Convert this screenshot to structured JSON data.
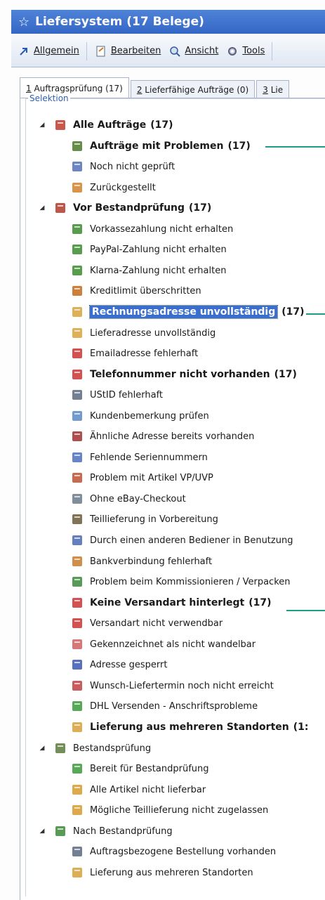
{
  "window": {
    "title": "Liefersystem (17 Belege)"
  },
  "toolbar": [
    {
      "label": "Allgemein",
      "icon": "arrow-icon"
    },
    {
      "label": "Bearbeiten",
      "icon": "edit-icon"
    },
    {
      "label": "Ansicht",
      "icon": "view-icon"
    },
    {
      "label": "Tools",
      "icon": "tools-icon"
    }
  ],
  "tabs": [
    {
      "num": "1",
      "label": "Auftragsprüfung (17)"
    },
    {
      "num": "2",
      "label": "Lieferfähige Aufträge (0)"
    },
    {
      "num": "3",
      "label": "Lie"
    }
  ],
  "group": {
    "label": "Selektion"
  },
  "tree": [
    {
      "label": "Alle Aufträge",
      "count": "(17)",
      "bold": true,
      "level": 0,
      "expander": "open",
      "icon": "door-icon",
      "color": "#c0392b"
    },
    {
      "label": "Aufträge mit Problemen",
      "count": "(17)",
      "bold": true,
      "level": 1,
      "icon": "document-warning-icon",
      "color": "#4a7a2a"
    },
    {
      "label": "Noch nicht geprüft",
      "count": "",
      "bold": false,
      "level": 1,
      "icon": "document-icon",
      "color": "#5470b8"
    },
    {
      "label": "Zurückgestellt",
      "count": "",
      "bold": false,
      "level": 1,
      "icon": "document-back-icon",
      "color": "#d4802a"
    },
    {
      "label": "Vor Bestandprüfung",
      "count": "(17)",
      "bold": true,
      "level": 0,
      "expander": "open",
      "icon": "box-icon",
      "color": "#b23a2a"
    },
    {
      "label": "Vorkassezahlung nicht erhalten",
      "count": "",
      "bold": false,
      "level": 1,
      "icon": "money-icon",
      "color": "#3c8b2e"
    },
    {
      "label": "PayPal-Zahlung nicht erhalten",
      "count": "",
      "bold": false,
      "level": 1,
      "icon": "money-icon",
      "color": "#3c8b2e"
    },
    {
      "label": "Klarna-Zahlung nicht erhalten",
      "count": "",
      "bold": false,
      "level": 1,
      "icon": "money-icon",
      "color": "#3c8b2e"
    },
    {
      "label": "Kreditlimit überschritten",
      "count": "",
      "bold": false,
      "level": 1,
      "icon": "user-warning-icon",
      "color": "#c46a1a"
    },
    {
      "label": "Rechnungsadresse unvollständig",
      "count": "(17)",
      "bold": true,
      "level": 1,
      "icon": "address-icon",
      "color": "#d8a23a",
      "highlight": true
    },
    {
      "label": "Lieferadresse unvollständig",
      "count": "",
      "bold": false,
      "level": 1,
      "icon": "address-icon",
      "color": "#d8a23a"
    },
    {
      "label": "Emailadresse fehlerhaft",
      "count": "",
      "bold": false,
      "level": 1,
      "icon": "mail-error-icon",
      "color": "#cc3333"
    },
    {
      "label": "Telefonnummer nicht vorhanden",
      "count": "(17)",
      "bold": true,
      "level": 1,
      "icon": "phone-error-icon",
      "color": "#cc3333"
    },
    {
      "label": "UStID fehlerhaft",
      "count": "",
      "bold": false,
      "level": 1,
      "icon": "id-icon",
      "color": "#5a6a80"
    },
    {
      "label": "Kundenbemerkung prüfen",
      "count": "",
      "bold": false,
      "level": 1,
      "icon": "comment-icon",
      "color": "#5a88c8"
    },
    {
      "label": "Ähnliche Adresse bereits vorhanden",
      "count": "",
      "bold": false,
      "level": 1,
      "icon": "people-icon",
      "color": "#a03030"
    },
    {
      "label": "Fehlende Seriennummern",
      "count": "",
      "bold": false,
      "level": 1,
      "icon": "serial-icon",
      "color": "#4e6ec0"
    },
    {
      "label": "Problem mit Artikel VP/UVP",
      "count": "",
      "bold": false,
      "level": 1,
      "icon": "article-icon",
      "color": "#c05030"
    },
    {
      "label": "Ohne eBay-Checkout",
      "count": "",
      "bold": false,
      "level": 1,
      "icon": "clock-document-icon",
      "color": "#6a7a8a"
    },
    {
      "label": "Teillieferung in Vorbereitung",
      "count": "",
      "bold": false,
      "level": 1,
      "icon": "truck-icon",
      "color": "#6a5a3a"
    },
    {
      "label": "Durch einen anderen Bediener in Benutzung",
      "count": "",
      "bold": false,
      "level": 1,
      "icon": "user-lock-icon",
      "color": "#4a6ab0"
    },
    {
      "label": "Bankverbindung fehlerhaft",
      "count": "",
      "bold": false,
      "level": 1,
      "icon": "bank-icon",
      "color": "#c87a2a"
    },
    {
      "label": "Problem beim Kommissionieren / Verpacken",
      "count": "",
      "bold": false,
      "level": 1,
      "icon": "package-icon",
      "color": "#3a8a3a"
    },
    {
      "label": "Keine Versandart hinterlegt",
      "count": "(17)",
      "bold": true,
      "level": 1,
      "icon": "shipping-error-icon",
      "color": "#cc3333"
    },
    {
      "label": "Versandart nicht verwendbar",
      "count": "",
      "bold": false,
      "level": 1,
      "icon": "shipping-error-icon",
      "color": "#cc3333"
    },
    {
      "label": "Gekennzeichnet als nicht wandelbar",
      "count": "",
      "bold": false,
      "level": 1,
      "icon": "flag-icon",
      "color": "#d06060"
    },
    {
      "label": "Adresse gesperrt",
      "count": "",
      "bold": false,
      "level": 1,
      "icon": "lock-icon",
      "color": "#3a58b0"
    },
    {
      "label": "Wunsch-Liefertermin noch nicht erreicht",
      "count": "",
      "bold": false,
      "level": 1,
      "icon": "calendar-icon",
      "color": "#c04040"
    },
    {
      "label": "DHL Versenden - Anschriftsprobleme",
      "count": "",
      "bold": false,
      "level": 1,
      "icon": "dhl-icon",
      "color": "#3a9a3a"
    },
    {
      "label": "Lieferung aus mehreren Standorten",
      "count": "(1:",
      "bold": true,
      "level": 1,
      "icon": "warehouse-icon",
      "color": "#d8a03a"
    },
    {
      "label": "Bestandsprüfung",
      "count": "",
      "bold": false,
      "level": 0,
      "expander": "open",
      "icon": "inventory-icon",
      "color": "#5a7a3a"
    },
    {
      "label": "Bereit für Bestandprüfung",
      "count": "",
      "bold": false,
      "level": 1,
      "icon": "check-document-icon",
      "color": "#3a9a3a"
    },
    {
      "label": "Alle Artikel nicht lieferbar",
      "count": "",
      "bold": false,
      "level": 1,
      "icon": "article-error-icon",
      "color": "#d89a2a"
    },
    {
      "label": "Mögliche Teillieferung nicht zugelassen",
      "count": "",
      "bold": false,
      "level": 1,
      "icon": "article-error-icon",
      "color": "#d89a2a"
    },
    {
      "label": "Nach Bestandprüfung",
      "count": "",
      "bold": false,
      "level": 0,
      "expander": "open",
      "icon": "inventory-icon",
      "color": "#3a8a3a"
    },
    {
      "label": "Auftragsbezogene Bestellung vorhanden",
      "count": "",
      "bold": false,
      "level": 1,
      "icon": "order-icon",
      "color": "#5a6a80"
    },
    {
      "label": "Lieferung aus mehreren Standorten",
      "count": "",
      "bold": false,
      "level": 1,
      "icon": "warehouse-icon",
      "color": "#d8a03a"
    }
  ]
}
